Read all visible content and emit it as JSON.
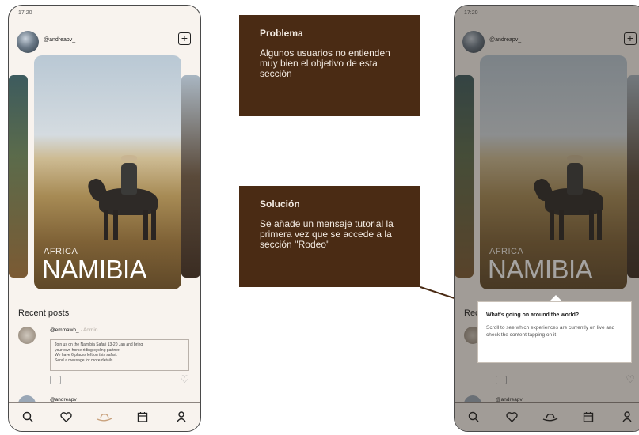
{
  "left_phone": {
    "status_time": "17:20",
    "username": "@andreapv_",
    "hero_region": "AFRICA",
    "hero_title": "NAMIBIA",
    "recent_posts_title": "Recent posts",
    "post1": {
      "user": "@emmawh_",
      "role": " · Admin",
      "lines": [
        "Join us on the Namibia Safari 13-20 Jan and bring",
        "your own horse riding cycling partner.",
        "We have 6 places left on this safari.",
        "Send a message for more details."
      ]
    },
    "post2_user": "@andreapv_"
  },
  "right_phone": {
    "status_time": "17:20",
    "username": "@andreapv_",
    "hero_region": "AFRICA",
    "hero_title": "NAMIBIA",
    "recent_partial": "Rece",
    "post2_user": "@andreapv"
  },
  "tooltip": {
    "title": "What's going on around the world?",
    "body": "Scroll to see which experiences are currently on live and check the content tapping on it"
  },
  "callouts": {
    "problem_title": "Problema",
    "problem_body": "Algunos usuarios no entienden muy bien el objetivo de esta sección",
    "solution_title": "Solución",
    "solution_body": "Se añade un mensaje tutorial la primera vez que se accede a la sección ''Rodeo''"
  },
  "colors": {
    "callout_bg": "#4a2b14",
    "phone_bg": "#f8f3ee",
    "active_tab": "#c9a27e"
  },
  "icons": [
    "search-icon",
    "heart-icon",
    "hat-icon",
    "calendar-icon",
    "user-icon",
    "plus-icon"
  ]
}
